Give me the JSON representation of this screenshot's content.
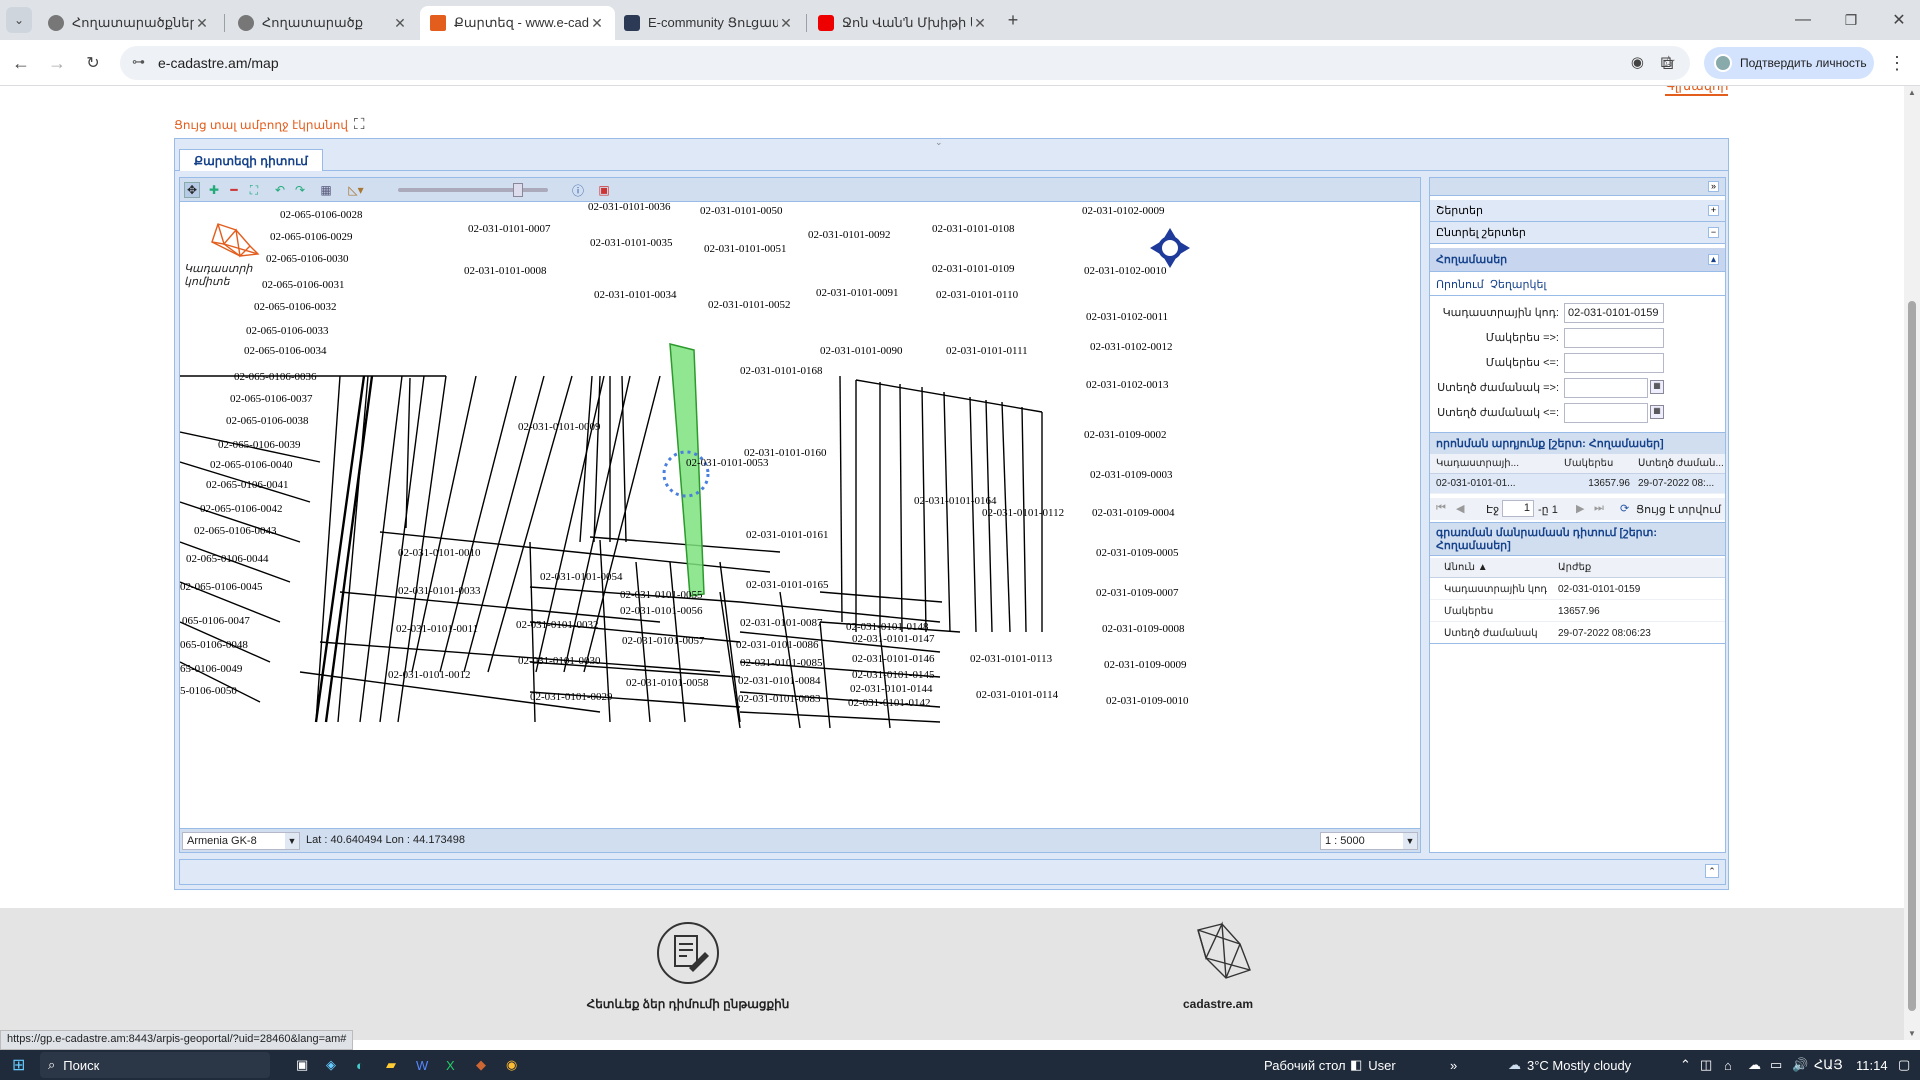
{
  "browser": {
    "tabs": [
      {
        "label": "Հողատարածքներ",
        "active": false
      },
      {
        "label": "Հողատարածք",
        "active": false
      },
      {
        "label": "Քարտեզ - www.e-cadastre.am",
        "active": true
      },
      {
        "label": "E-community Ցուցատախտակ",
        "active": false
      },
      {
        "label": "Ջոն Վան'ն Մխիթի և Վարագ",
        "active": false
      }
    ],
    "url": "e-cadastre.am/map",
    "verify_label": "Подтвердить личность"
  },
  "page": {
    "top_link": "Գլխավոր",
    "fullscreen_link": "Ցույց տալ ամբողջ էկրանով",
    "map_tab": "Քարտեզի դիտում",
    "projection": "Armenia GK-8",
    "coords": "Lat : 40.640494  Lon : 44.173498",
    "scale": "1 : 5000",
    "logo_text": "Կադաստրի կոմիտե"
  },
  "side": {
    "acc_layers": "Շերտեր",
    "acc_selected_layers": "Ընտրել շերտեր",
    "acc_parcels": "Հողամասեր",
    "subtab_search": "Որոնում",
    "subtab_clear": "Չեղարկել",
    "form": {
      "cadastral_code_label": "Կադաստրային կոդ:",
      "cadastral_code_value": "02-031-0101-0159",
      "area_from_label": "Մակերես =>:",
      "area_to_label": "Մակերես <=:",
      "date_from_label": "Ստեղծ ժամանակ =>:",
      "date_to_label": "Ստեղծ ժամանակ <=:"
    },
    "results_title": "որոնման արդյունք [շերտ: Հողամասեր]",
    "results_cols": [
      "Կադաստրայի...",
      "Մակերես",
      "Ստեղծ ժաման..."
    ],
    "results_row": [
      "02-031-0101-01...",
      "13657.96",
      "29-07-2022 08:..."
    ],
    "pager": {
      "page_label": "Էջ",
      "page": "1",
      "of": "-ը 1",
      "show_label": "Ցույց է տրվում"
    },
    "details_title": "գրառման մանրամասն դիտում [շերտ: Հողամասեր]",
    "details_cols": [
      "Անուն ▲",
      "Արժեք"
    ],
    "details": [
      {
        "name": "Կադաստրային կոդ",
        "value": "02-031-0101-0159"
      },
      {
        "name": "Մակերես",
        "value": "13657.96"
      },
      {
        "name": "Ստեղծ ժամանակ",
        "value": "29-07-2022 08:06:23"
      }
    ]
  },
  "footer": {
    "left_label": "Հետևեք ձեր դիմումի ընթացքին",
    "right_label": "cadastre.am",
    "status_url": "https://gp.e-cadastre.am:8443/arpis-geoportal/?uid=28460&lang=am#"
  },
  "taskbar": {
    "search": "Поиск",
    "desktop": "Рабочий стол",
    "user": "User",
    "weather": "3°C  Mostly cloudy",
    "lang": "ՀԱՅ",
    "time": "11:14"
  },
  "map_labels": [
    [
      "02-065-0106-0028"
    ],
    [
      "02-065-0106-0029"
    ],
    [
      "02-065-0106-0030"
    ],
    [
      "02-065-0106-0031"
    ],
    [
      "02-065-0106-0032"
    ],
    [
      "02-065-0106-0033"
    ],
    [
      "02-065-0106-0034"
    ],
    [
      "02-031-0101-0036"
    ],
    [
      "02-031-0101-0050"
    ],
    [
      "02-031-0101-0007"
    ],
    [
      "02-031-0101-0035"
    ],
    [
      "02-031-0101-0051"
    ],
    [
      "02-031-0101-0092"
    ],
    [
      "02-031-0101-0108"
    ],
    [
      "02-031-0102-0009"
    ],
    [
      "02-031-0101-0008"
    ],
    [
      "02-031-0101-0109"
    ],
    [
      "02-031-0102-0010"
    ],
    [
      "02-031-0101-0034"
    ],
    [
      "02-031-0101-0052"
    ],
    [
      "02-031-0101-0091"
    ],
    [
      "02-031-0101-0110"
    ],
    [
      "02-031-0102-0011"
    ],
    [
      "02-031-0102-0012"
    ],
    [
      "02-031-0101-0090"
    ],
    [
      "02-031-0101-0111"
    ],
    [
      "02-031-0101-0168"
    ],
    [
      "02-031-0102-0013"
    ],
    [
      "02-031-0101-0009"
    ],
    [
      "02-031-0109-0002"
    ],
    [
      "02-031-0101-0160"
    ],
    [
      "02-031-0101-0053"
    ],
    [
      "02-031-0109-0003"
    ],
    [
      "02-031-0101-0164"
    ],
    [
      "02-031-0101-0112"
    ],
    [
      "02-031-0109-0004"
    ],
    [
      "02-031-0101-0161"
    ],
    [
      "02-031-0101-0010"
    ],
    [
      "02-031-0109-0005"
    ],
    [
      "02-031-0101-0054"
    ],
    [
      "02-031-0101-0033"
    ],
    [
      "02-031-0101-0055"
    ],
    [
      "02-031-0101-0165"
    ],
    [
      "02-031-0109-0007"
    ],
    [
      "02-031-0101-0056"
    ],
    [
      "02-031-0101-0087"
    ],
    [
      "02-031-0101-0148"
    ],
    [
      "02-031-0101-0011"
    ],
    [
      "02-031-0101-0032"
    ],
    [
      "02-031-0101-0057"
    ],
    [
      "02-031-0101-0086"
    ],
    [
      "02-031-0101-0147"
    ],
    [
      "02-031-0109-0008"
    ],
    [
      "02-031-0101-0030"
    ],
    [
      "02-031-0101-0085"
    ],
    [
      "02-031-0101-0146"
    ],
    [
      "02-031-0101-0113"
    ],
    [
      "02-031-0101-0012"
    ],
    [
      "02-031-0101-0058"
    ],
    [
      "02-031-0101-0084"
    ],
    [
      "02-031-0101-0145"
    ],
    [
      "02-031-0109-0009"
    ],
    [
      "02-031-0101-0029"
    ],
    [
      "02-031-0101-0083"
    ],
    [
      "02-031-0101-0144"
    ],
    [
      "02-031-0101-0114"
    ],
    [
      "02-031-0101-0142"
    ],
    [
      "02-031-0109-0010"
    ],
    [
      "02-065-0106-0036"
    ],
    [
      "02-065-0106-0037"
    ],
    [
      "02-065-0106-0038"
    ],
    [
      "02-065-0106-0039"
    ],
    [
      "02-065-0106-0040"
    ],
    [
      "02-065-0106-0041"
    ],
    [
      "02-065-0106-0042"
    ],
    [
      "02-065-0106-0043"
    ],
    [
      "02-065-0106-0044"
    ],
    [
      "02-065-0106-0045"
    ],
    [
      "065-0106-0047"
    ],
    [
      "065-0106-0048"
    ],
    [
      "65-0106-0049"
    ],
    [
      "5-0106-0050"
    ]
  ]
}
